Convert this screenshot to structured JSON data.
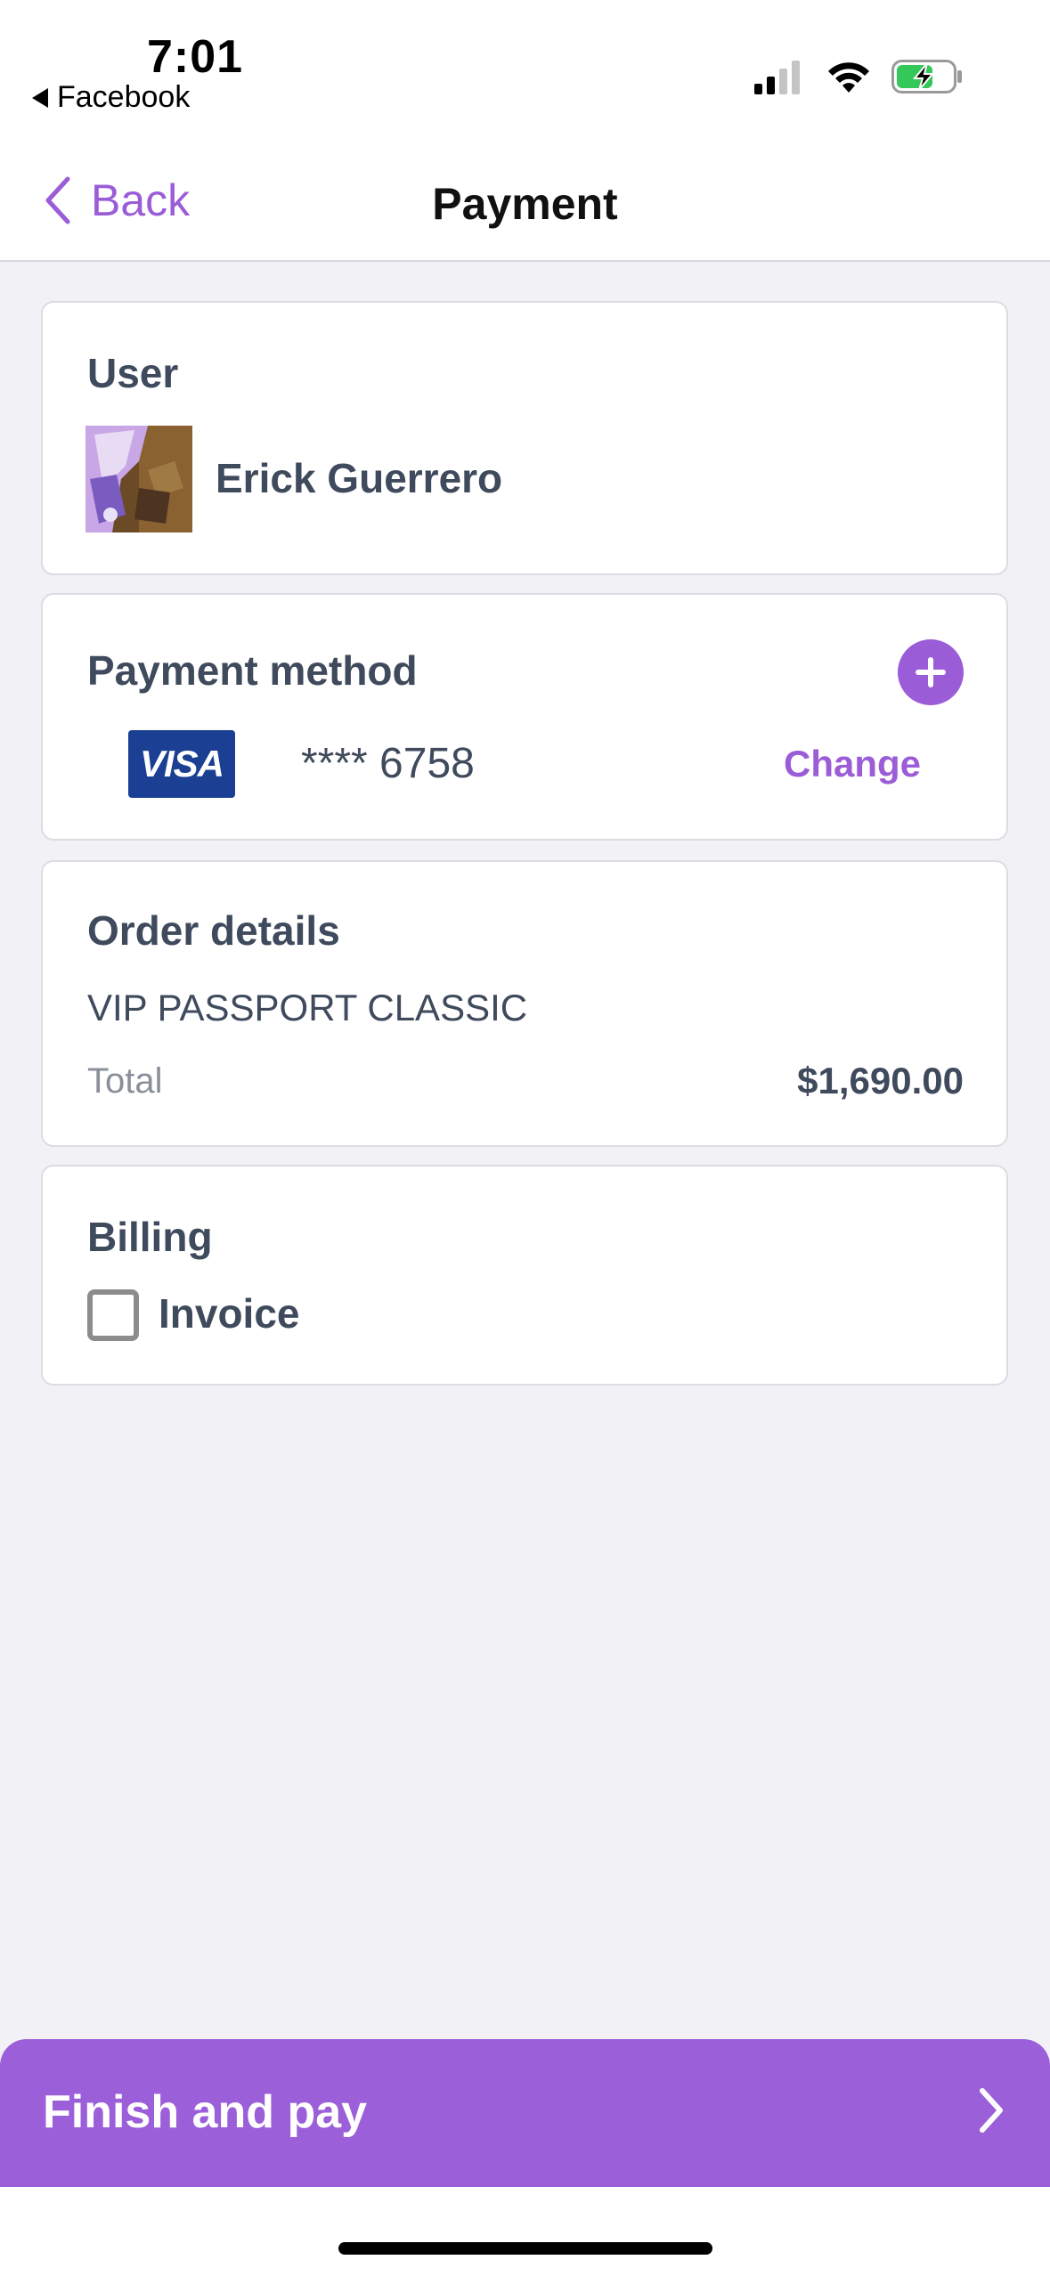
{
  "status_bar": {
    "time": "7:01",
    "back_app": "Facebook",
    "signal_icon": "cellular-signal-icon",
    "wifi_icon": "wifi-icon",
    "battery_icon": "battery-charging-icon"
  },
  "nav": {
    "back_label": "Back",
    "title": "Payment"
  },
  "user_card": {
    "heading": "User",
    "name": "Erick Guerrero"
  },
  "payment_card": {
    "heading": "Payment method",
    "card_brand": "VISA",
    "card_number": "**** 6758",
    "change_label": "Change",
    "add_icon": "plus-icon"
  },
  "order_card": {
    "heading": "Order details",
    "product": "VIP PASSPORT CLASSIC",
    "total_label": "Total",
    "total_value": "$1,690.00"
  },
  "billing_card": {
    "heading": "Billing",
    "invoice_label": "Invoice",
    "invoice_checked": false
  },
  "footer": {
    "pay_label": "Finish and pay"
  },
  "colors": {
    "accent": "#9b5cd8",
    "background": "#f1f1f6",
    "text": "#3f4a5c",
    "visa_blue": "#1a3f93"
  }
}
